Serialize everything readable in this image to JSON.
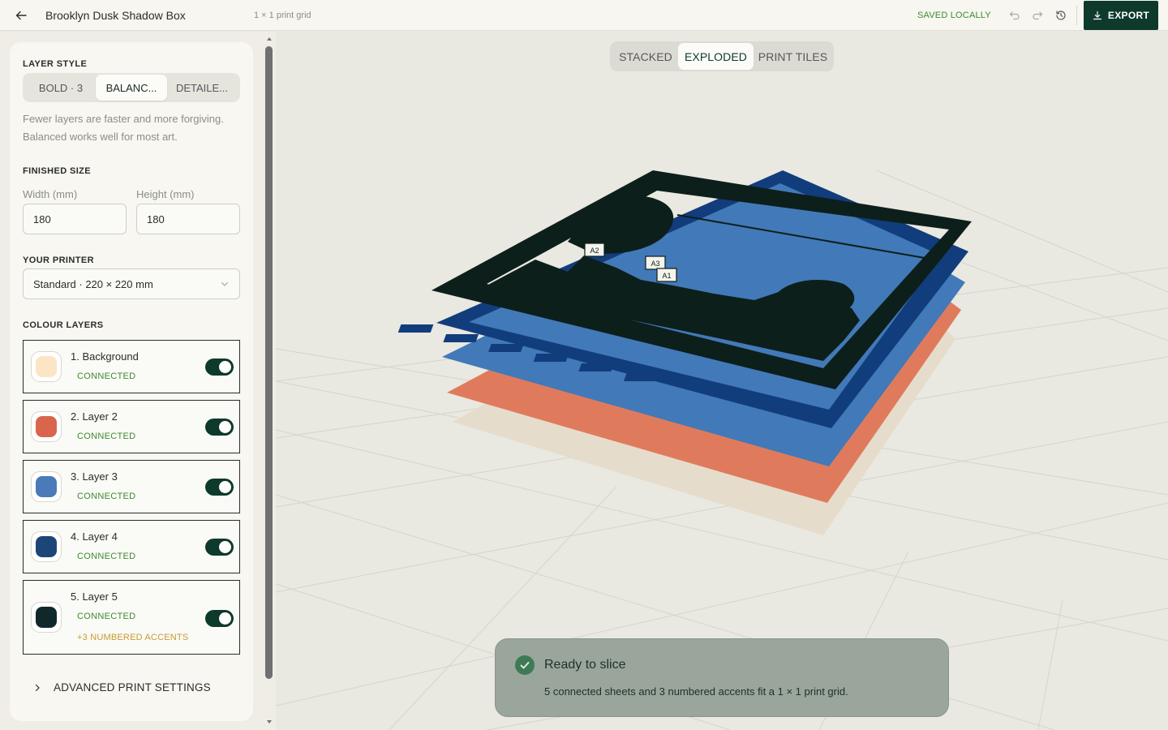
{
  "header": {
    "project_title": "Brooklyn Dusk Shadow Box",
    "grid_label": "1 × 1 print grid",
    "saved_status": "SAVED LOCALLY",
    "export_label": "EXPORT"
  },
  "sidebar": {
    "layer_style": {
      "label": "LAYER STYLE",
      "options": [
        "BOLD · 3",
        "BALANC...",
        "DETAILE..."
      ],
      "selected": "BALANC...",
      "hint": "Fewer layers are faster and more forgiving. Balanced works well for most art."
    },
    "finished_size": {
      "label": "FINISHED SIZE",
      "width_label": "Width (mm)",
      "width_value": "180",
      "height_label": "Height (mm)",
      "height_value": "180"
    },
    "printer": {
      "label": "YOUR PRINTER",
      "selected": "Standard · 220 × 220 mm"
    },
    "colour_layers": {
      "label": "COLOUR LAYERS",
      "items": [
        {
          "name": "1. Background",
          "status": "CONNECTED",
          "color": "#fbe5c4",
          "enabled": true
        },
        {
          "name": "2. Layer 2",
          "status": "CONNECTED",
          "color": "#d9654d",
          "enabled": true
        },
        {
          "name": "3. Layer 3",
          "status": "CONNECTED",
          "color": "#4a7bb8",
          "enabled": true
        },
        {
          "name": "4. Layer 4",
          "status": "CONNECTED",
          "color": "#1d4577",
          "enabled": true
        },
        {
          "name": "5. Layer 5",
          "status": "CONNECTED",
          "note": "+3 NUMBERED ACCENTS",
          "color": "#10282a",
          "enabled": true
        }
      ]
    },
    "advanced_label": "ADVANCED PRINT SETTINGS"
  },
  "viewport": {
    "view_modes": [
      "STACKED",
      "EXPLODED",
      "PRINT TILES"
    ],
    "selected_view": "EXPLODED",
    "accent_tags": [
      "A2",
      "A3",
      "A1"
    ],
    "colors": {
      "background_layer": "#e6dccb",
      "layer_2": "#df7b5c",
      "layer_3": "#4279b8",
      "layer_4": "#123d7c",
      "layer_5": "#0d1f1b"
    }
  },
  "toast": {
    "title": "Ready to slice",
    "body": "5 connected sheets and 3 numbered accents fit a 1 × 1 print grid."
  },
  "colors": {
    "accent": "#0e3a2b",
    "connected": "#3d8a2e",
    "note": "#c79a2f"
  }
}
